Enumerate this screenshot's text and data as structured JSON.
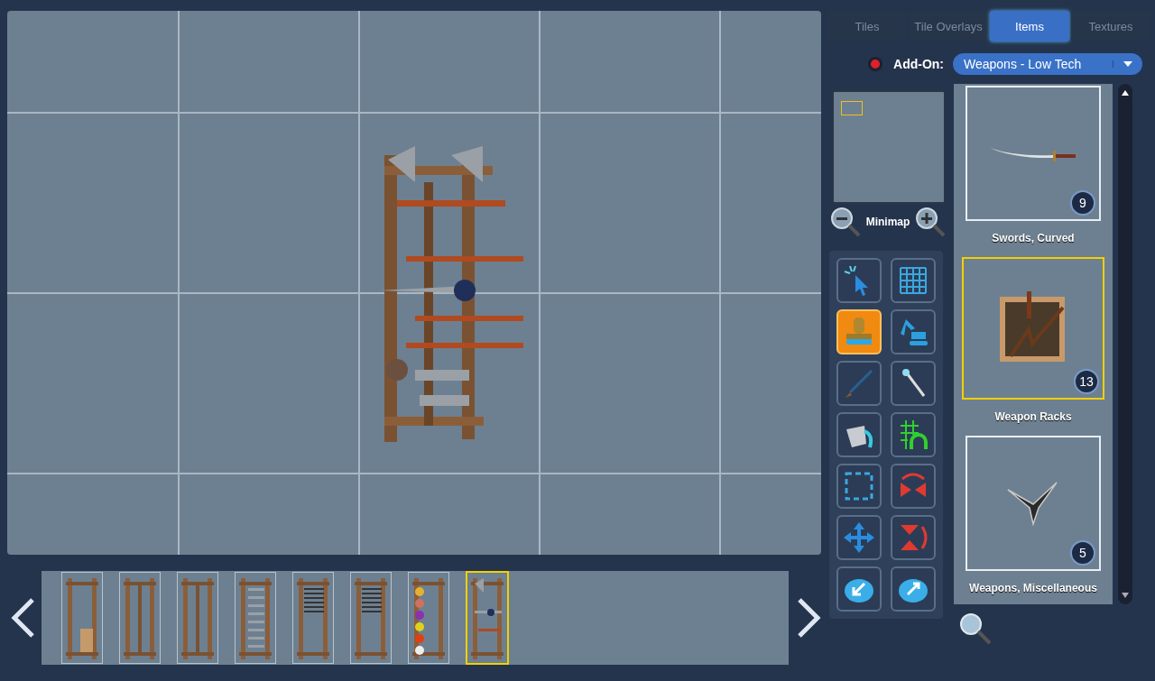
{
  "tabs": [
    {
      "label": "Tiles",
      "selected": false
    },
    {
      "label": "Tile Overlays",
      "selected": false
    },
    {
      "label": "Items",
      "selected": true
    },
    {
      "label": "Textures",
      "selected": false
    }
  ],
  "addon": {
    "label": "Add-On:",
    "value": "Weapons - Low Tech"
  },
  "minimap": {
    "label": "Minimap"
  },
  "tools": [
    {
      "kind": "select",
      "selected": false
    },
    {
      "kind": "grid",
      "selected": false
    },
    {
      "kind": "stamp",
      "selected": true
    },
    {
      "kind": "excavator",
      "selected": false
    },
    {
      "kind": "brush",
      "selected": false
    },
    {
      "kind": "wand",
      "selected": false
    },
    {
      "kind": "bucket",
      "selected": false
    },
    {
      "kind": "snap",
      "selected": false
    },
    {
      "kind": "marquee",
      "selected": false
    },
    {
      "kind": "flip-h",
      "selected": false
    },
    {
      "kind": "move",
      "selected": false
    },
    {
      "kind": "flip-v",
      "selected": false
    },
    {
      "kind": "import",
      "selected": false
    },
    {
      "kind": "export",
      "selected": false
    }
  ],
  "categories": [
    {
      "name": "Swords, Curved",
      "count": "9",
      "kind": "sword",
      "selected": false
    },
    {
      "name": "Weapon Racks",
      "count": "13",
      "kind": "rack",
      "selected": true
    },
    {
      "name": "Weapons, Miscellaneous",
      "count": "5",
      "kind": "star",
      "selected": false
    }
  ],
  "filmstrip": [
    {
      "kind": "rack-board",
      "selected": false
    },
    {
      "kind": "rack-empty",
      "selected": false
    },
    {
      "kind": "rack-pegs",
      "selected": false
    },
    {
      "kind": "rack-blades",
      "selected": false
    },
    {
      "kind": "rack-tools",
      "selected": false
    },
    {
      "kind": "rack-tools",
      "selected": false
    },
    {
      "kind": "rack-maces",
      "selected": false
    },
    {
      "kind": "rack-full",
      "selected": true
    }
  ]
}
